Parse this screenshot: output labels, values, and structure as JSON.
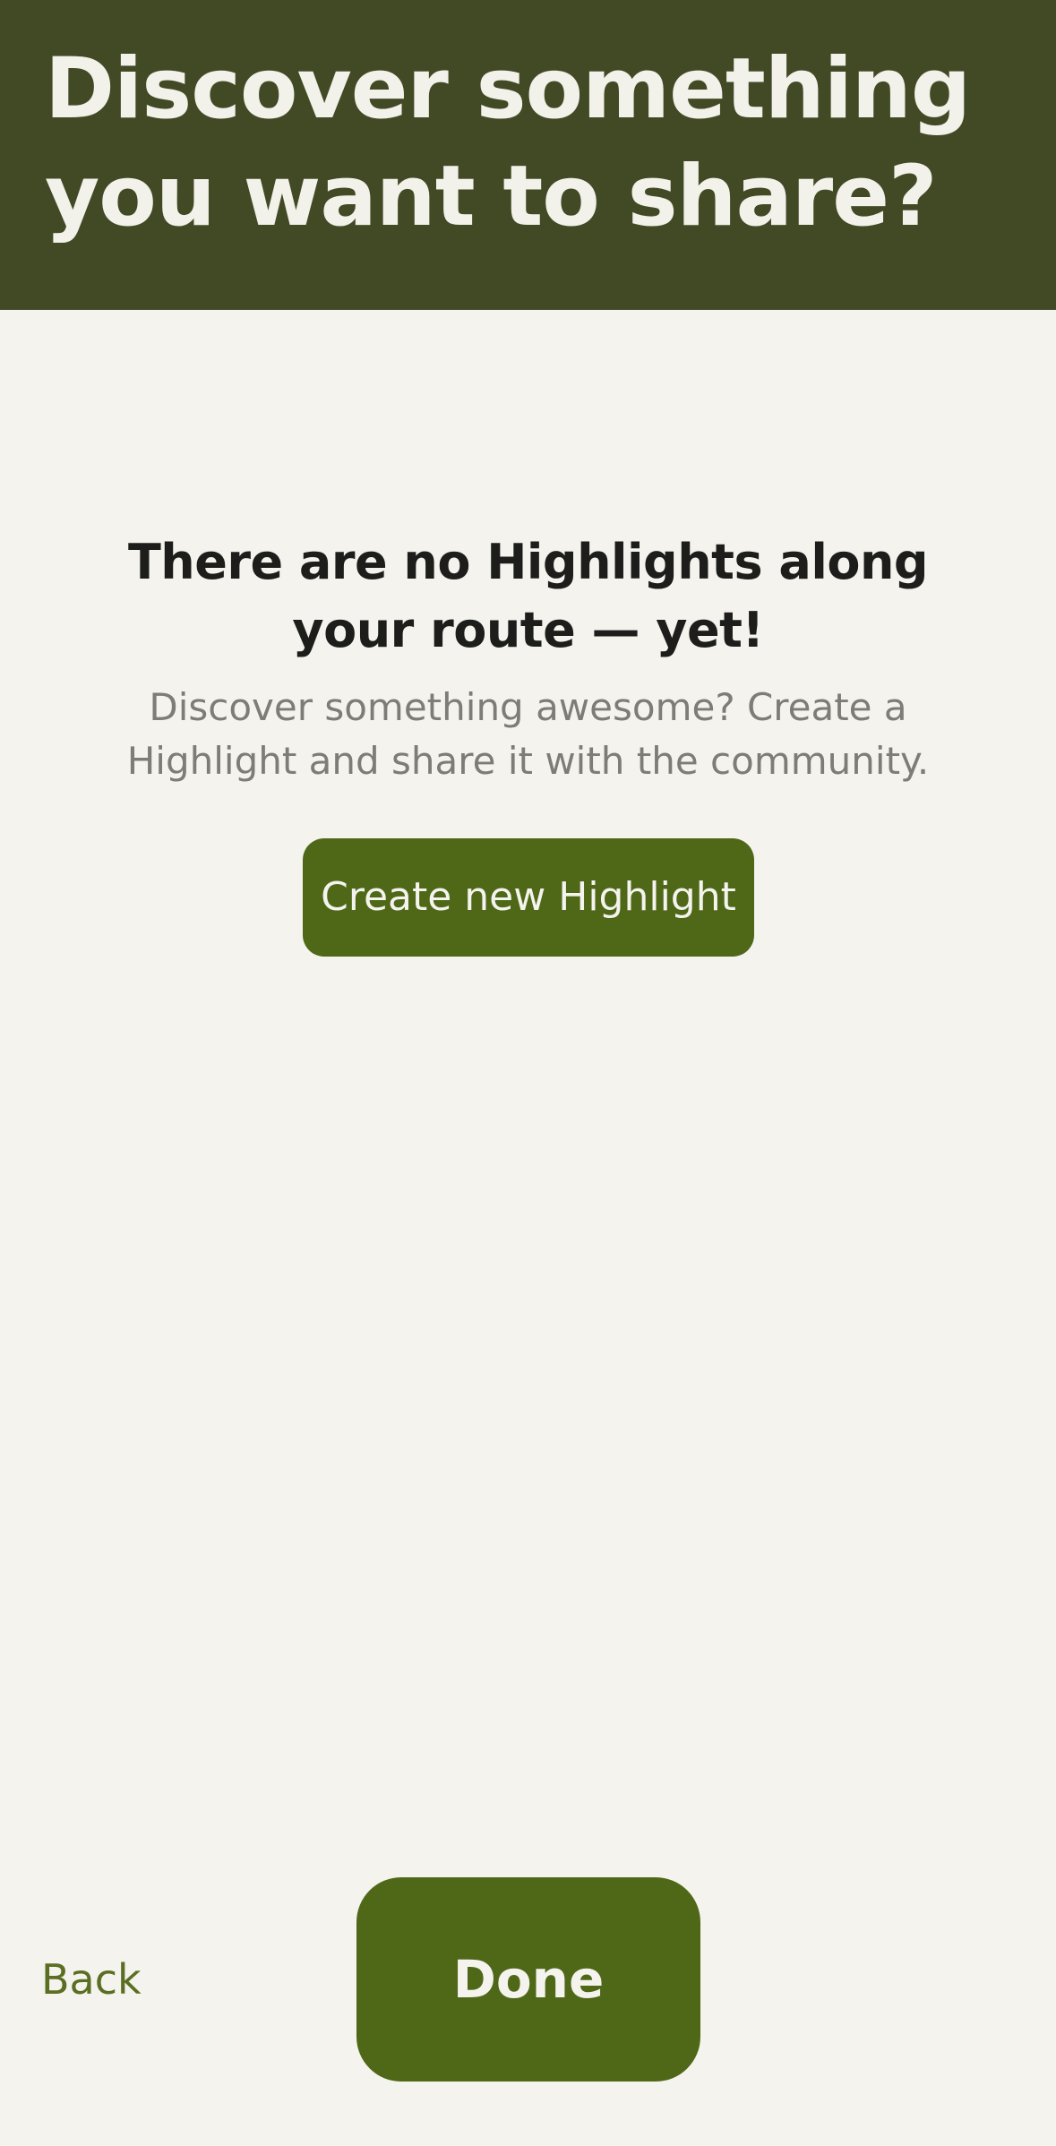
{
  "header": {
    "title": "Discover something you want to share?"
  },
  "empty_state": {
    "title": "There are no Highlights along your route — yet!",
    "description": "Discover something awesome? Create a Highlight and share it with the community.",
    "create_button_label": "Create new Highlight"
  },
  "footer": {
    "back_label": "Back",
    "done_label": "Done"
  },
  "colors": {
    "header_background": "#414a24",
    "page_background": "#f4f3ee",
    "primary_button": "#4f6818",
    "back_link": "#5b6e22"
  }
}
